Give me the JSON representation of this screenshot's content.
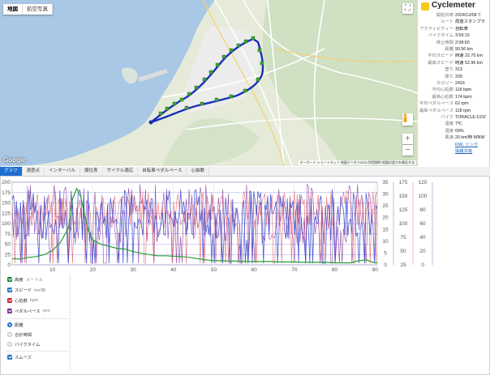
{
  "map": {
    "type_buttons": [
      "地図",
      "航空写真"
    ],
    "active_type": 0,
    "google_label": "Google",
    "attribution": "キーボード ショートカット   地図データ ©2024   利用規約   地図の誤りを報告する",
    "colors": {
      "sea": "#a9c8e6",
      "land": "#e6ead9",
      "forest": "#cfe0c3",
      "urban": "#ececec",
      "route": "#1b2fb8",
      "marker": "#3aa435"
    }
  },
  "info": {
    "brand": "Cyclemeter",
    "rows": [
      {
        "k": "開始日時",
        "v": "2024/12/08 7:"
      },
      {
        "k": "ルート",
        "v": "周遊スタンプラ"
      },
      {
        "k": "アクティビティー",
        "v": "自転車"
      },
      {
        "k": "バイクタイム",
        "v": "3:59:19"
      },
      {
        "k": "停止時間",
        "v": "2:08:50"
      },
      {
        "k": "距離",
        "v": "90.56 km"
      },
      {
        "k": "平均スピード",
        "v": "時速 22.70 km"
      },
      {
        "k": "最高スピード",
        "v": "時速 52.96 km"
      },
      {
        "k": "登り",
        "v": "313"
      },
      {
        "k": "降り",
        "v": "339"
      },
      {
        "k": "カロリー",
        "v": "2416"
      },
      {
        "k": "平均心拍数",
        "v": "118 bpm"
      },
      {
        "k": "最高心拍数",
        "v": "174 bpm"
      },
      {
        "k": "平均ペダルペース",
        "v": "62 rpm"
      },
      {
        "k": "最高ペダルペース",
        "v": "118 rpm"
      },
      {
        "k": "バイク",
        "v": "TORACLE-COZ"
      },
      {
        "k": "温度",
        "v": "7ºC"
      },
      {
        "k": "湿度",
        "v": "69%"
      },
      {
        "k": "風速",
        "v": "20 km/時 WNW"
      },
      {
        "k": "",
        "v": "KML リンク",
        "link": true
      },
      {
        "k": "",
        "v": "情報共有",
        "link": true
      }
    ]
  },
  "tabs": [
    "グラフ",
    "速度点",
    "インターバル",
    "順位表",
    "サイクル適応",
    "自転車ペダルペース",
    "心拍数"
  ],
  "active_tab": 0,
  "chart_data": {
    "type": "line",
    "x": {
      "min": 0,
      "max": 90.56,
      "ticks": [
        10,
        20,
        30,
        40,
        50,
        60,
        70,
        80,
        90
      ]
    },
    "axes": {
      "elevation": {
        "min": 0,
        "max": 200,
        "ticks": [
          0,
          25,
          50,
          75,
          100,
          125,
          150,
          175,
          200
        ]
      },
      "speed": {
        "min": 0,
        "max": 35,
        "ticks": [
          0,
          5,
          10,
          15,
          20,
          25,
          30,
          35
        ]
      },
      "heart_rate": {
        "min": 25,
        "max": 175,
        "ticks": [
          25,
          50,
          75,
          100,
          125,
          150,
          175
        ]
      },
      "cadence": {
        "min": 0,
        "max": 120,
        "ticks": [
          0,
          20,
          40,
          60,
          80,
          100,
          120
        ]
      }
    },
    "series": [
      {
        "name": "高度",
        "color": "#28a032",
        "axis": "elevation",
        "x": [
          0,
          2,
          4,
          6,
          8,
          10,
          12,
          14,
          15,
          16,
          17,
          18,
          19,
          20,
          22,
          24,
          26,
          28,
          30,
          32,
          34,
          36,
          38,
          40,
          42,
          44,
          46,
          48,
          50,
          52,
          54,
          56,
          58,
          60,
          62,
          64,
          66,
          68,
          70,
          72,
          74,
          76,
          78,
          80,
          82,
          84,
          86,
          88,
          89,
          90,
          90.56
        ],
        "values": [
          15,
          14,
          18,
          20,
          25,
          35,
          55,
          90,
          160,
          185,
          165,
          120,
          80,
          60,
          50,
          45,
          40,
          38,
          32,
          28,
          25,
          22,
          22,
          21,
          20,
          18,
          15,
          12,
          10,
          10,
          9,
          9,
          8,
          8,
          8,
          8,
          7,
          7,
          7,
          6,
          6,
          6,
          6,
          5,
          5,
          5,
          10,
          12,
          8,
          5,
          5
        ]
      },
      {
        "name": "スピード",
        "color": "#3b4bd0",
        "axis": "speed",
        "summary": {
          "avg": 22.7,
          "max": 52.96
        }
      },
      {
        "name": "心拍数",
        "color": "#e24b57",
        "axis": "heart_rate",
        "summary": {
          "avg": 118,
          "max": 174
        }
      },
      {
        "name": "ペダルペース",
        "color": "#7b2a8f",
        "axis": "cadence",
        "summary": {
          "avg": 62,
          "max": 118
        }
      }
    ]
  },
  "legend": {
    "series": [
      {
        "label": "高度",
        "unit": "メートル",
        "color": "#1d8a35"
      },
      {
        "label": "スピード",
        "unit": "km/時",
        "color": "#2172c7"
      },
      {
        "label": "心拍数",
        "unit": "bpm",
        "color": "#d11d2e"
      },
      {
        "label": "ペダルペース",
        "unit": "rpm",
        "color": "#7b2a8f"
      }
    ],
    "x_options": [
      "距離",
      "合計時間",
      "バイクタイム"
    ],
    "x_selected": 0,
    "smooth_label": "スムーズ"
  }
}
